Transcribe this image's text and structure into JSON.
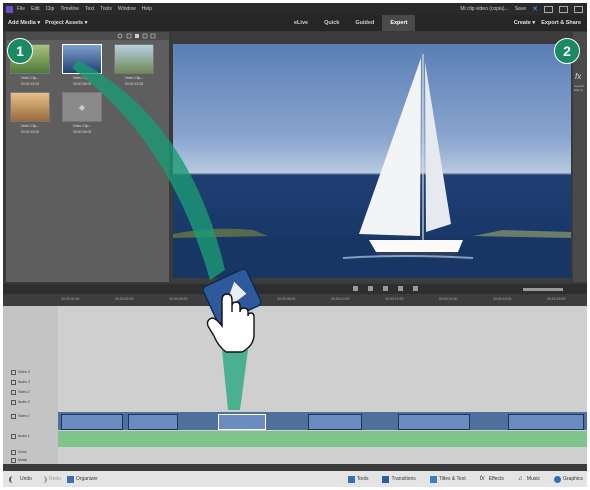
{
  "menu": {
    "items": [
      "File",
      "Edit",
      "Clip",
      "Timeline",
      "Text",
      "Tools",
      "Window",
      "Help"
    ],
    "project": "Mi clip video (copia)...",
    "save": "Save"
  },
  "toolbar": {
    "add_media": "Add Media ▾",
    "project_assets": "Project Assets ▾",
    "modes": [
      "eLive",
      "Quick",
      "Guided",
      "Expert"
    ],
    "active_mode": "Expert",
    "create": "Create ▾",
    "export_share": "Export & Share"
  },
  "assets": {
    "items": [
      {
        "name": "Video Clip...",
        "time": "00:00:15:00",
        "color": "#6a8f4a"
      },
      {
        "name": "Video Clip...",
        "time": "00:00:08:00",
        "color": "#3d6aa8"
      },
      {
        "name": "Video Clip...",
        "time": "00:00:12:00",
        "color": "#8aa070"
      },
      {
        "name": "Video Clip...",
        "time": "00:00:10:00",
        "color": "#c89a5a"
      },
      {
        "name": "Video Clip...",
        "time": "00:00:05:00",
        "color": "#8a8a8a"
      }
    ]
  },
  "side_panel": {
    "fx": "fx",
    "label": "Applied Effects"
  },
  "timeline": {
    "tracks": [
      "Video 3",
      "Audio 3",
      "Video 2",
      "Audio 2",
      "Video 1",
      "Audio 1",
      "Voice",
      "Music"
    ],
    "ruler": [
      "00:00:00:00",
      "00:00:02:00",
      "00:00:04:00",
      "00:00:06:00",
      "00:00:08:00",
      "00:00:10:00",
      "00:00:12:00",
      "00:00:14:00",
      "00:00:16:00",
      "00:00:18:00"
    ]
  },
  "bottom": {
    "undo": "Undo",
    "redo": "Redo",
    "organizer": "Organizer",
    "tools": "Tools",
    "transitions": "Transitions",
    "titles": "Titles & Text",
    "effects": "Effects",
    "music": "Music",
    "graphics": "Graphics"
  },
  "callouts": [
    "1",
    "2"
  ],
  "colors": {
    "accent": "#1b8a62"
  }
}
